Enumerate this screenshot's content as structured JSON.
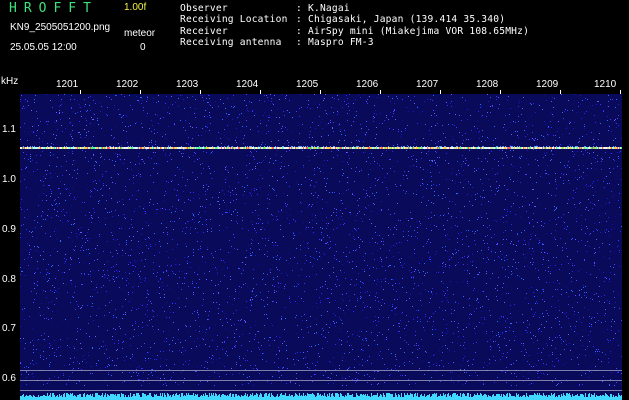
{
  "header": {
    "app_title": "HROFFT",
    "version": "1.00f",
    "filename": "KN9_2505051200.png",
    "mode_label": "meteor",
    "datetime": "25.05.05 12:00",
    "count": "0",
    "info": [
      {
        "label": "Observer",
        "value": "K.Nagai"
      },
      {
        "label": "Receiving Location",
        "value": "Chigasaki, Japan (139.414 35.340)"
      },
      {
        "label": "Receiver",
        "value": "AirSpy mini (Miakejima VOR 108.65MHz)"
      },
      {
        "label": "Receiving antenna",
        "value": "Maspro FM-3"
      }
    ]
  },
  "axis": {
    "unit": "kHz",
    "minutes": [
      "1201",
      "1202",
      "1203",
      "1204",
      "1205",
      "1206",
      "1207",
      "1208",
      "1209",
      "1210"
    ],
    "freqs": [
      "1.1",
      "1.0",
      "0.9",
      "0.8",
      "0.7",
      "0.6"
    ]
  },
  "colors": {
    "background": "#000000",
    "plot_bg": "#0a0a5a",
    "title_green": "#3ee27a",
    "version_yellow": "#f2f24a",
    "carrier": "#e8e0a0",
    "noise_floor": "#40d8ff"
  }
}
